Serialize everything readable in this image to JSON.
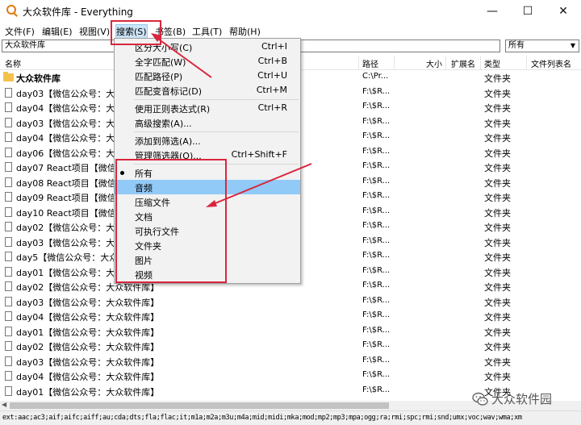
{
  "window": {
    "title": "大众软件库 - Everything",
    "controls": {
      "minimize": "—",
      "maximize": "☐",
      "close": "✕"
    }
  },
  "menubar": [
    {
      "label": "文件(F)",
      "key": "file"
    },
    {
      "label": "编辑(E)",
      "key": "edit"
    },
    {
      "label": "视图(V)",
      "key": "view"
    },
    {
      "label": "搜索(S)",
      "key": "search",
      "active": true
    },
    {
      "label": "书签(B)",
      "key": "bookmarks"
    },
    {
      "label": "工具(T)",
      "key": "tools"
    },
    {
      "label": "帮助(H)",
      "key": "help"
    }
  ],
  "search": {
    "value": "大众软件库",
    "filter": "所有"
  },
  "columns": [
    "名称",
    "路径",
    "大小",
    "扩展名",
    "类型",
    "文件列表名"
  ],
  "rows": [
    {
      "name": "大众软件库",
      "path": "C:\\Pr...",
      "type": "文件夹",
      "icon": "folder"
    },
    {
      "name": "day03【微信公众号：大众软件库】",
      "path": "F:\\$R...",
      "type": "文件夹",
      "icon": "doc"
    },
    {
      "name": "day04【微信公众号：大众软件库】",
      "path": "F:\\$R...",
      "type": "文件夹",
      "icon": "doc"
    },
    {
      "name": "day03【微信公众号：大众软件库】",
      "path": "F:\\$R...",
      "type": "文件夹",
      "icon": "doc"
    },
    {
      "name": "day04【微信公众号：大众软件库】",
      "path": "F:\\$R...",
      "type": "文件夹",
      "icon": "doc"
    },
    {
      "name": "day06【微信公众号：大众软件库】",
      "path": "F:\\$R...",
      "type": "文件夹",
      "icon": "doc"
    },
    {
      "name": "day07 React项目【微信公众号：大众软件库】",
      "path": "F:\\$R...",
      "type": "文件夹",
      "icon": "doc"
    },
    {
      "name": "day08 React项目【微信公众号：大众软件库】",
      "path": "F:\\$R...",
      "type": "文件夹",
      "icon": "doc"
    },
    {
      "name": "day09 React项目【微信公众号：大众软件库】",
      "path": "F:\\$R...",
      "type": "文件夹",
      "icon": "doc"
    },
    {
      "name": "day10 React项目【微信公众号：大众软件库】",
      "path": "F:\\$R...",
      "type": "文件夹",
      "icon": "doc"
    },
    {
      "name": "day02【微信公众号：大众软件库】",
      "path": "F:\\$R...",
      "type": "文件夹",
      "icon": "doc"
    },
    {
      "name": "day03【微信公众号：大众软件库】",
      "path": "F:\\$R...",
      "type": "文件夹",
      "icon": "doc"
    },
    {
      "name": "day5【微信公众号：大众软件库】",
      "path": "F:\\$R...",
      "type": "文件夹",
      "icon": "doc"
    },
    {
      "name": "day01【微信公众号：大众软件库】",
      "path": "F:\\$R...",
      "type": "文件夹",
      "icon": "doc"
    },
    {
      "name": "day02【微信公众号：大众软件库】",
      "path": "F:\\$R...",
      "type": "文件夹",
      "icon": "doc"
    },
    {
      "name": "day03【微信公众号：大众软件库】",
      "path": "F:\\$R...",
      "type": "文件夹",
      "icon": "doc"
    },
    {
      "name": "day04【微信公众号：大众软件库】",
      "path": "F:\\$R...",
      "type": "文件夹",
      "icon": "doc"
    },
    {
      "name": "day01【微信公众号：大众软件库】",
      "path": "F:\\$R...",
      "type": "文件夹",
      "icon": "doc"
    },
    {
      "name": "day02【微信公众号：大众软件库】",
      "path": "F:\\$R...",
      "type": "文件夹",
      "icon": "doc"
    },
    {
      "name": "day03【微信公众号：大众软件库】",
      "path": "F:\\$R...",
      "type": "文件夹",
      "icon": "doc"
    },
    {
      "name": "day04【微信公众号：大众软件库】",
      "path": "F:\\$R...",
      "type": "文件夹",
      "icon": "doc"
    },
    {
      "name": "day01【微信公众号：大众软件库】",
      "path": "F:\\$R...",
      "type": "文件夹",
      "icon": "doc"
    }
  ],
  "search_menu": {
    "options": [
      {
        "label": "区分大小写(C)",
        "shortcut": "Ctrl+I"
      },
      {
        "label": "全字匹配(W)",
        "shortcut": "Ctrl+B"
      },
      {
        "label": "匹配路径(P)",
        "shortcut": "Ctrl+U"
      },
      {
        "label": "匹配变音标记(D)",
        "shortcut": "Ctrl+M"
      }
    ],
    "regex": [
      {
        "label": "使用正则表达式(R)",
        "shortcut": "Ctrl+R"
      },
      {
        "label": "高级搜索(A)...",
        "shortcut": ""
      }
    ],
    "filter_actions": [
      {
        "label": "添加到筛选(A)...",
        "shortcut": ""
      },
      {
        "label": "管理筛选器(O)...",
        "shortcut": "Ctrl+Shift+F"
      }
    ],
    "filters": [
      {
        "label": "所有",
        "selected": true
      },
      {
        "label": "音频",
        "highlighted": true
      },
      {
        "label": "压缩文件"
      },
      {
        "label": "文档"
      },
      {
        "label": "可执行文件"
      },
      {
        "label": "文件夹"
      },
      {
        "label": "图片"
      },
      {
        "label": "视频"
      }
    ]
  },
  "status": "ext:aac;ac3;aif;aifc;aiff;au;cda;dts;fla;flac;it;m1a;m2a;m3u;m4a;mid;midi;mka;mod;mp2;mp3;mpa;ogg;ra;rmi;spc;rmi;snd;umx;voc;wav;wma;xm",
  "watermark": "大众软件园",
  "colors": {
    "annotation": "#d9263e",
    "highlight": "#91c9f7",
    "folder": "#f4c14a",
    "app_icon": "#e07a10"
  }
}
